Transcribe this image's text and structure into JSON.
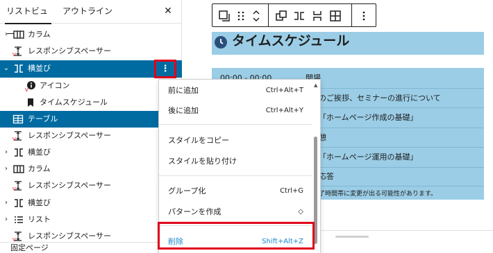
{
  "list_view": {
    "tabs": [
      {
        "label": "リストビュー",
        "active": true
      },
      {
        "label": "アウトライン",
        "active": false
      }
    ],
    "close_symbol": "✕",
    "rows": [
      {
        "label": "カラム",
        "icon": "columns-icon",
        "expandable": true,
        "selected": false,
        "indent": 0
      },
      {
        "label": "レスポンシブスペーサー",
        "icon": "spacer-icon",
        "expandable": false,
        "selected": false,
        "indent": 0
      },
      {
        "label": "横並び",
        "icon": "row-icon",
        "expandable": true,
        "expanded": true,
        "selected": true,
        "indent": 0
      },
      {
        "label": "アイコン",
        "icon": "info-icon",
        "expandable": false,
        "selected": false,
        "indent": 1
      },
      {
        "label": "タイムスケジュール",
        "icon": "bookmark-icon",
        "expandable": false,
        "selected": false,
        "indent": 1
      },
      {
        "label": "テーブル",
        "icon": "table-icon",
        "expandable": false,
        "selected": true,
        "indent": 0
      },
      {
        "label": "レスポンシブスペーサー",
        "icon": "spacer-icon",
        "expandable": false,
        "selected": false,
        "indent": 0
      },
      {
        "label": "横並び",
        "icon": "row-icon",
        "expandable": true,
        "selected": false,
        "indent": 0
      },
      {
        "label": "カラム",
        "icon": "columns-icon",
        "expandable": true,
        "selected": false,
        "indent": 0
      },
      {
        "label": "レスポンシブスペーサー",
        "icon": "spacer-icon",
        "expandable": false,
        "selected": false,
        "indent": 0
      },
      {
        "label": "横並び",
        "icon": "row-icon",
        "expandable": true,
        "selected": false,
        "indent": 0
      },
      {
        "label": "リスト",
        "icon": "list-icon",
        "expandable": true,
        "selected": false,
        "indent": 0
      },
      {
        "label": "レスポンシブスペーサー",
        "icon": "spacer-icon",
        "expandable": false,
        "selected": false,
        "indent": 0
      }
    ],
    "options_symbol": "⋮",
    "footer": "固定ページ"
  },
  "context_menu": {
    "groups": [
      [
        {
          "label": "前に追加",
          "shortcut": "Ctrl+Alt+T"
        },
        {
          "label": "後に追加",
          "shortcut": "Ctrl+Alt+Y"
        }
      ],
      [
        {
          "label": "スタイルをコピー",
          "shortcut": ""
        },
        {
          "label": "スタイルを貼り付け",
          "shortcut": ""
        }
      ],
      [
        {
          "label": "グループ化",
          "shortcut": "Ctrl+G"
        },
        {
          "label": "パターンを作成",
          "shortcut": "◇"
        }
      ],
      [
        {
          "label": "削除",
          "shortcut": "Shift+Alt+Z"
        }
      ]
    ]
  },
  "editor": {
    "title": "タイムスケジュール",
    "table_rows": [
      {
        "time": "00:00 - 00:00",
        "text": "開場"
      },
      {
        "time": "",
        "text": "のご挨拶、セミナーの進行について"
      },
      {
        "time": "",
        "text": "「ホームページ作成の基礎」"
      },
      {
        "time": "",
        "text": "憩"
      },
      {
        "time": "",
        "text": "「ホームページ運用の基礎」"
      },
      {
        "time": "",
        "text": "応答"
      }
    ],
    "note": "了時間帯に変更が出る可能性があります。"
  },
  "colors": {
    "selected_row": "#006ba1",
    "highlight_box": "#e0001b",
    "block_background": "#9bcde6",
    "delete_text": "#1e88c8"
  }
}
